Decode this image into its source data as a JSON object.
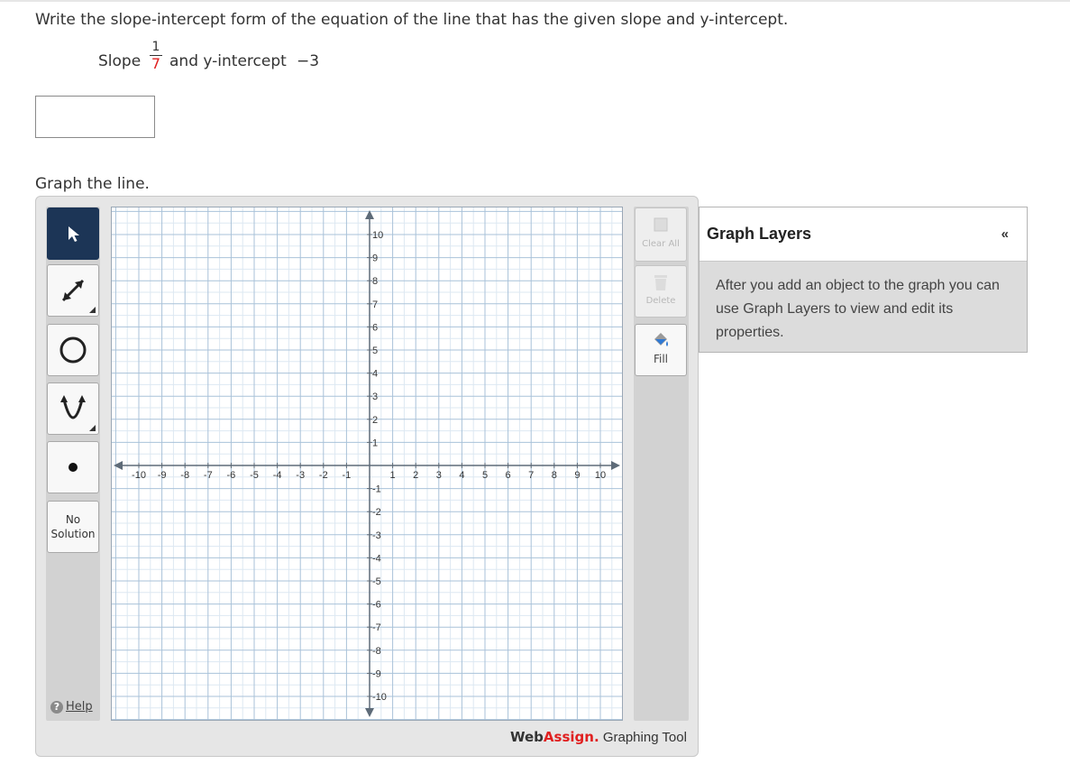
{
  "question": {
    "prompt": "Write the slope-intercept form of the equation of the line that has the given slope and y-intercept.",
    "slope_label": "Slope",
    "slope_numerator": "1",
    "slope_denominator": "7",
    "and_label": "and y-intercept",
    "intercept_value": "−3",
    "answer_value": "",
    "graph_prompt": "Graph the line."
  },
  "toolbar": {
    "tools": [
      {
        "name": "pointer",
        "icon": "pointer-arrow-icon",
        "active": true
      },
      {
        "name": "line",
        "icon": "line-tool-icon"
      },
      {
        "name": "circle",
        "icon": "circle-tool-icon"
      },
      {
        "name": "parabola",
        "icon": "parabola-tool-icon"
      },
      {
        "name": "point",
        "icon": "point-tool-icon"
      }
    ],
    "no_solution_line1": "No",
    "no_solution_line2": "Solution",
    "help_label": "Help"
  },
  "graph": {
    "x_ticks": [
      "-10",
      "-9",
      "-8",
      "-7",
      "-6",
      "-5",
      "-4",
      "-3",
      "-2",
      "-1",
      "1",
      "2",
      "3",
      "4",
      "5",
      "6",
      "7",
      "8",
      "9",
      "10"
    ],
    "y_ticks": [
      "10",
      "9",
      "8",
      "7",
      "6",
      "5",
      "4",
      "3",
      "2",
      "1",
      "-1",
      "-2",
      "-3",
      "-4",
      "-5",
      "-6",
      "-7",
      "-8",
      "-9",
      "-10"
    ],
    "x_range": [
      -10,
      10
    ],
    "y_range": [
      -10,
      10
    ],
    "grid": true,
    "colors": {
      "major_grid": "#a9c2d9",
      "minor_grid": "#dde8f2",
      "axis": "#5e6b78"
    }
  },
  "side_buttons": {
    "clear_all_label": "Clear All",
    "delete_label": "Delete",
    "fill_label": "Fill"
  },
  "branding": {
    "web": "Web",
    "assign": "Assign.",
    "rest": " Graphing Tool"
  },
  "layers": {
    "title": "Graph Layers",
    "collapse_glyph": "«",
    "body": "After you add an object to the graph you can use Graph Layers to view and edit its properties."
  }
}
